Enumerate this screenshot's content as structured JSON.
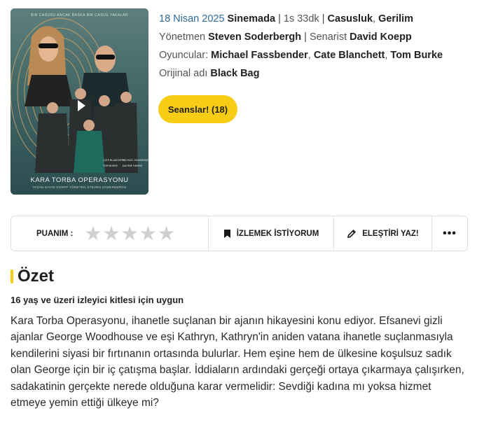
{
  "poster": {
    "tagline": "BIR CASUSU ANCAK BASKA BIR CASUS YAKALAR",
    "title": "KARA TORBA OPERASYONU",
    "credits": "YAZAN DAVID KOEPP   YÖNETEN STEVEN SODERBERGH"
  },
  "info": {
    "release_date": "18 Nisan 2025",
    "release_status": "Sinemada",
    "duration": "1s 33dk",
    "genre1": "Casusluk",
    "genre2": "Gerilim",
    "director_label": "Yönetmen",
    "director": "Steven Soderbergh",
    "writer_label": "Senarist",
    "writer": "David Koepp",
    "cast_label": "Oyuncular:",
    "cast1": "Michael Fassbender",
    "cast2": "Cate Blanchett",
    "cast3": "Tom Burke",
    "original_label": "Orijinal adı",
    "original_title": "Black Bag"
  },
  "seans_button": "Seanslar! (18)",
  "rating_bar": {
    "rating_label": "PUANIM :",
    "stars_filled": 0,
    "stars_total": 5,
    "watch_label": "İZLEMEK İSTİYORUM",
    "review_label": "ELEŞTİRİ YAZ!",
    "more_label": "•••"
  },
  "summary": {
    "heading": "Özet",
    "age_rating": "16 yaş ve üzeri izleyici kitlesi için uygun",
    "text": "Kara Torba Operasyonu, ihanetle suçlanan bir ajanın hikayesini konu ediyor. Efsanevi gizli ajanlar George Woodhouse ve eşi Kathryn, Kathryn'in aniden vatana ihanetle suçlanmasıyla kendilerini siyasi bir fırtınanın ortasında bulurlar. Hem eşine hem de ülkesine koşulsuz sadık olan George için bir iç çatışma başlar. İddiaların ardındaki gerçeği ortaya çıkarmaya çalışırken, sadakatinin gerçekte nerede olduğuna karar vermelidir: Sevdiği kadına mı yoksa hizmet etmeye yemin ettiği ülkeye mi?"
  },
  "colors": {
    "accent": "#f6cc15",
    "link_blue": "#2d6b9a",
    "star_empty": "#cfcfcf"
  },
  "icons": {
    "play": "play-icon",
    "star": "star-icon",
    "bookmark": "bookmark-icon",
    "pencil": "pencil-icon",
    "more": "more-dots-icon"
  }
}
